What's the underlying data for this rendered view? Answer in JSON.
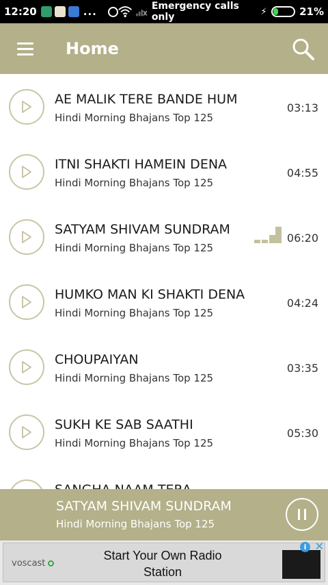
{
  "status_bar": {
    "time": "12:20",
    "dots": "...",
    "network": "Emergency calls only",
    "battery": "21%",
    "battery_level": 0.21
  },
  "header": {
    "title": "Home"
  },
  "songs": [
    {
      "title": "AE MALIK TERE BANDE HUM",
      "album": "Hindi Morning Bhajans Top 125",
      "duration": "03:13"
    },
    {
      "title": "ITNI SHAKTI HAMEIN DENA",
      "album": "Hindi Morning Bhajans Top 125",
      "duration": "04:55"
    },
    {
      "title": "SATYAM SHIVAM SUNDRAM",
      "album": "Hindi Morning Bhajans Top 125",
      "duration": "06:20",
      "playing": true
    },
    {
      "title": "HUMKO MAN KI SHAKTI DENA",
      "album": "Hindi Morning Bhajans Top 125",
      "duration": "04:24"
    },
    {
      "title": "CHOUPAIYAN",
      "album": "Hindi Morning Bhajans Top 125",
      "duration": "03:35"
    },
    {
      "title": "SUKH KE SAB SAATHI",
      "album": "Hindi Morning Bhajans Top 125",
      "duration": "05:30"
    },
    {
      "title": "SANGHA NAAM TERA",
      "album": "",
      "duration": ""
    }
  ],
  "now_playing": {
    "title": "SATYAM SHIVAM SUNDRAM",
    "album": "Hindi Morning Bhajans Top 125"
  },
  "ad": {
    "brand": "voscast",
    "text": "Start Your Own Radio Station",
    "info_icon": "i",
    "close_icon": "✕"
  },
  "colors": {
    "accent": "#b3b08a",
    "circle_border": "#c9c5a6"
  }
}
